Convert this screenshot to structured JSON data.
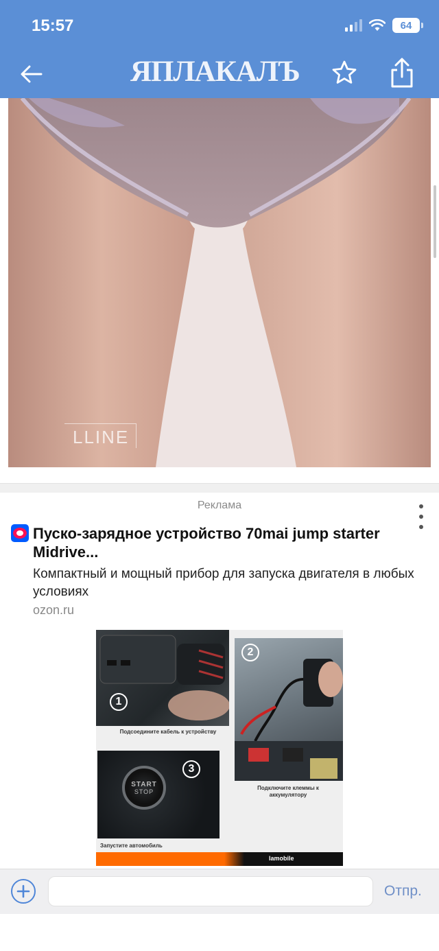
{
  "status_bar": {
    "time": "15:57",
    "battery": "64"
  },
  "header": {
    "logo": "ЯПЛАКАЛЪ"
  },
  "photo": {
    "watermark": "LLINE"
  },
  "ad": {
    "label": "Реклама",
    "title": "Пуско-зарядное устройство 70mai jump starter Midrive...",
    "description": "Компактный и мощный прибор для запуска двигателя в любых условиях",
    "domain": "ozon.ru",
    "image": {
      "steps": [
        "1",
        "2",
        "3"
      ],
      "caption_1": "Подсоедините кабель к устройству",
      "caption_2": "Подключите клеммы к аккумулятору",
      "caption_3": "Запустите автомобиль",
      "start_button_top": "START",
      "start_button_bottom": "STOP",
      "brand": "lamobile"
    }
  },
  "composer": {
    "placeholder": "",
    "send_label": "Отпр."
  },
  "colors": {
    "header": "#5b8fd6",
    "accent": "#4f86d8",
    "ozon_blue": "#005bff",
    "ozon_pink": "#f91155"
  }
}
